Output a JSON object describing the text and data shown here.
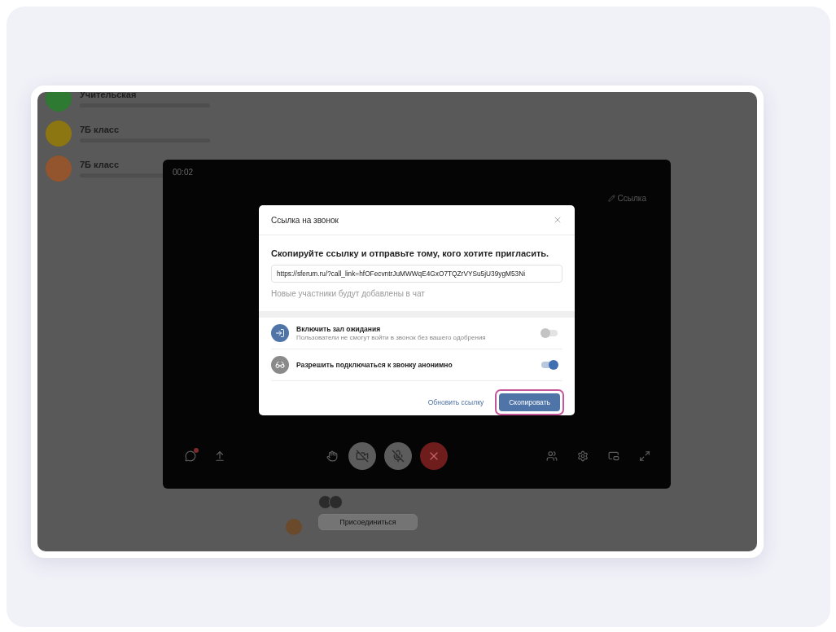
{
  "chats": [
    {
      "name": "Учительская",
      "color": "#2f7a32"
    },
    {
      "name": "7Б класс",
      "color": "#8c7612"
    },
    {
      "name": "7Б класс",
      "color": "#93552e"
    }
  ],
  "call": {
    "timer": "00:02",
    "link_label": "Ссылка",
    "controls": [
      {
        "kind": "chat",
        "badge": true
      },
      {
        "kind": "share"
      },
      {
        "kind": "hand"
      },
      {
        "kind": "video",
        "off": true
      },
      {
        "kind": "mic",
        "off": true
      },
      {
        "kind": "end"
      },
      {
        "kind": "people"
      },
      {
        "kind": "settings"
      },
      {
        "kind": "pip"
      },
      {
        "kind": "expand"
      }
    ]
  },
  "join_button": "Присоединиться",
  "dialog": {
    "title": "Ссылка на звонок",
    "heading": "Скопируйте ссылку и отправьте тому, кого хотите пригласить.",
    "link": "https://sferum.ru/?call_link=hfOFecvntrJuMWWqE4GxO7TQZrVYSu5jU39ygM53Ni",
    "note": "Новые участники будут добавлены в чат",
    "options": [
      {
        "kind": "waiting",
        "title": "Включить зал ожидания",
        "subtitle": "Пользователи не смогут войти в звонок без вашего одобрения",
        "on": false
      },
      {
        "kind": "anonymous",
        "title": "Разрешить подключаться к звонку анонимно",
        "on": true
      }
    ],
    "refresh_button": "Обновить ссылку",
    "copy_button": {
      "label": "Скопировать",
      "highlighted": true
    }
  }
}
